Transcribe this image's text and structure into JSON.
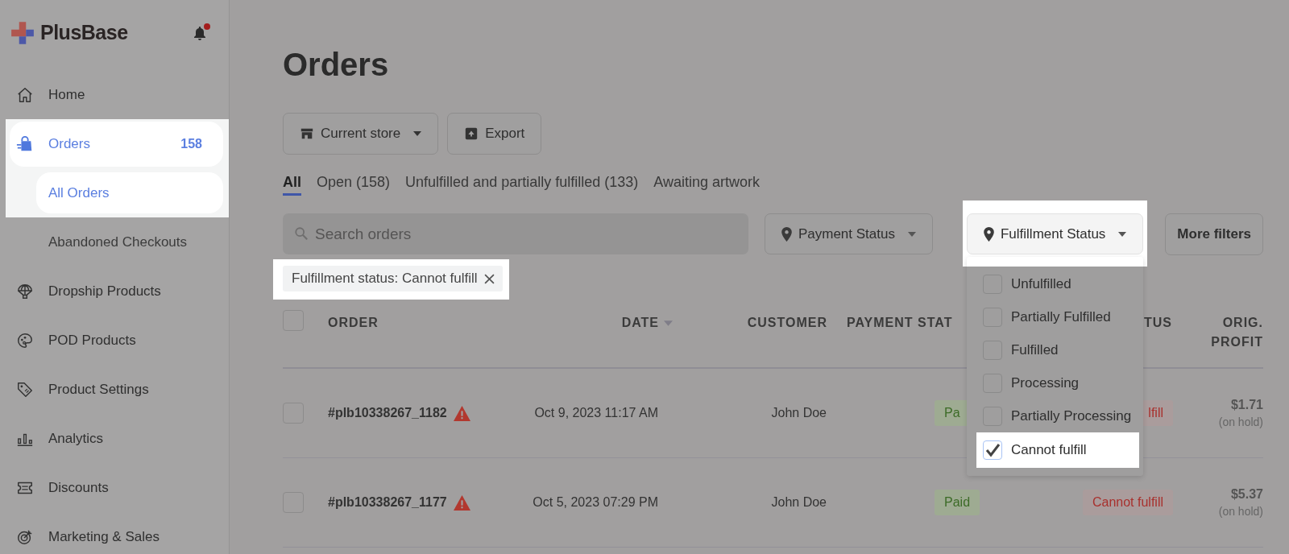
{
  "sidebar": {
    "brand": "PlusBase",
    "bell": {
      "unread": true
    },
    "items": [
      {
        "label": "Home",
        "selected": false,
        "highlighted": false
      },
      {
        "label": "Orders",
        "count": "158",
        "selected": true,
        "highlighted": true,
        "children": [
          {
            "label": "All Orders",
            "selected": true,
            "highlighted": true
          },
          {
            "label": "Abandoned Checkouts",
            "selected": false,
            "highlighted": false
          }
        ]
      },
      {
        "label": "Dropship Products",
        "selected": false,
        "highlighted": false
      },
      {
        "label": "POD Products",
        "selected": false,
        "highlighted": false
      },
      {
        "label": "Product Settings",
        "selected": false,
        "highlighted": false
      },
      {
        "label": "Analytics",
        "selected": false,
        "highlighted": false
      },
      {
        "label": "Discounts",
        "selected": false,
        "highlighted": false
      },
      {
        "label": "Marketing & Sales",
        "selected": false,
        "highlighted": false
      }
    ]
  },
  "page": {
    "title": "Orders",
    "actions": [
      {
        "label": "Current store",
        "kind": "dropdown"
      },
      {
        "label": "Export",
        "kind": "export"
      }
    ],
    "tabs": [
      {
        "label": "All",
        "selected": true
      },
      {
        "label": "Open (158)",
        "selected": false
      },
      {
        "label": "Unfulfilled and partially fulfilled (133)",
        "selected": false
      },
      {
        "label": "Awaiting artwork",
        "selected": false
      }
    ],
    "search": {
      "placeholder": "Search orders"
    },
    "filters": [
      {
        "label": "Payment Status",
        "highlighted": false
      },
      {
        "label": "Fulfillment Status",
        "highlighted": true,
        "options": [
          {
            "label": "Unfulfilled",
            "checked": false,
            "highlighted": false
          },
          {
            "label": "Partially Fulfilled",
            "checked": false,
            "highlighted": false
          },
          {
            "label": "Fulfilled",
            "checked": false,
            "highlighted": false
          },
          {
            "label": "Processing",
            "checked": false,
            "highlighted": false
          },
          {
            "label": "Partially Processing",
            "checked": false,
            "highlighted": false
          },
          {
            "label": "Cannot fulfill",
            "checked": true,
            "highlighted": true
          }
        ]
      }
    ],
    "more_filters": "More filters",
    "active_filters": [
      {
        "label": "Fulfillment status: Cannot fulfill",
        "highlighted": true
      }
    ],
    "table": {
      "all_checked": false,
      "columns": [
        {
          "label": "ORDER"
        },
        {
          "label": "DATE",
          "sorted": true
        },
        {
          "label": "CUSTOMER"
        },
        {
          "label": "PAYMENT STAT"
        },
        {
          "label": "TUS"
        },
        {
          "label": "ORIG. PROFIT"
        }
      ],
      "rows": [
        {
          "checked": false,
          "order": "#plb10338267_1182",
          "warning": true,
          "date": "Oct 9, 2023 11:17 AM",
          "customer": "John Doe",
          "payment": "Pa",
          "fulfillment": "lfill",
          "profit": "$1.71",
          "profit_note": "(on hold)"
        },
        {
          "checked": false,
          "order": "#plb10338267_1177",
          "warning": true,
          "date": "Oct 5, 2023 07:29 PM",
          "customer": "John Doe",
          "payment": "Paid",
          "fulfillment": "Cannot fulfill",
          "profit": "$5.37",
          "profit_note": "(on hold)"
        }
      ]
    }
  }
}
